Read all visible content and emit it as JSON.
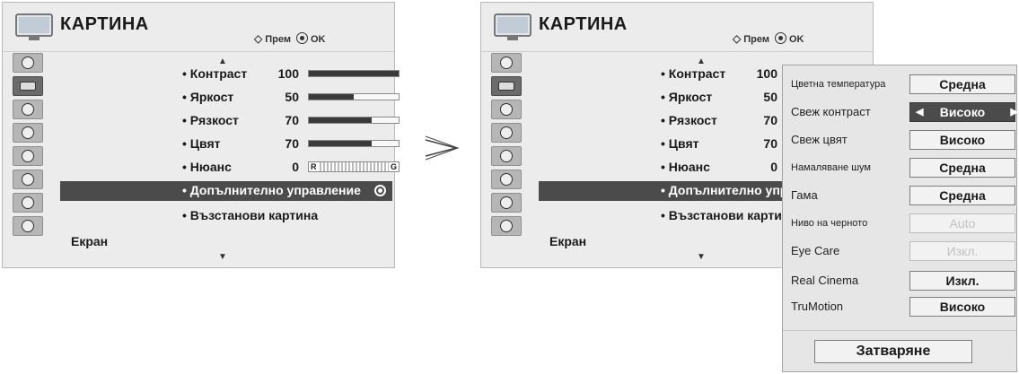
{
  "left_panel": {
    "title": "КАРТИНА",
    "nav_move": "Прем",
    "nav_ok": "OK",
    "rows": [
      {
        "label": "• Контраст",
        "value": "100",
        "level": 100
      },
      {
        "label": "• Яркост",
        "value": "50",
        "level": 50
      },
      {
        "label": "• Рязкост",
        "value": "70",
        "level": 70
      },
      {
        "label": "• Цвят",
        "value": "70",
        "level": 70
      },
      {
        "label": "• Нюанс",
        "value": "0",
        "tint_r": "R",
        "tint_g": "G"
      }
    ],
    "advanced": "• Допълнително управление",
    "reset": "• Възстанови картина",
    "screen": "Екран"
  },
  "right_panel": {
    "title": "КАРТИНА",
    "nav_move": "Прем",
    "nav_ok": "OK",
    "rows": [
      {
        "label": "• Контраст",
        "value": "100"
      },
      {
        "label": "• Яркост",
        "value": "50"
      },
      {
        "label": "• Рязкост",
        "value": "70"
      },
      {
        "label": "• Цвят",
        "value": "70"
      },
      {
        "label": "• Нюанс",
        "value": "0"
      }
    ],
    "advanced": "• Допълнително упра",
    "reset": "• Възстанови карти",
    "screen": "Екран"
  },
  "popup": {
    "rows": [
      {
        "label": "Цветна температура",
        "value": "Средна"
      },
      {
        "label": "Свеж контраст",
        "value": "Високо"
      },
      {
        "label": "Свеж цвят",
        "value": "Високо"
      },
      {
        "label": "Намаляване шум",
        "value": "Средна"
      },
      {
        "label": "Гама",
        "value": "Средна"
      },
      {
        "label": "Ниво на черното",
        "value": "Auto"
      },
      {
        "label": "Eye Care",
        "value": "Изкл."
      },
      {
        "label": "Real Cinema",
        "value": "Изкл."
      },
      {
        "label": "TruMotion",
        "value": "Високо"
      }
    ],
    "close": "Затваряне"
  },
  "colors": {
    "highlight": "#4b4b4b",
    "panel_bg": "#ececec",
    "popup_bg": "#e6e6e6"
  }
}
